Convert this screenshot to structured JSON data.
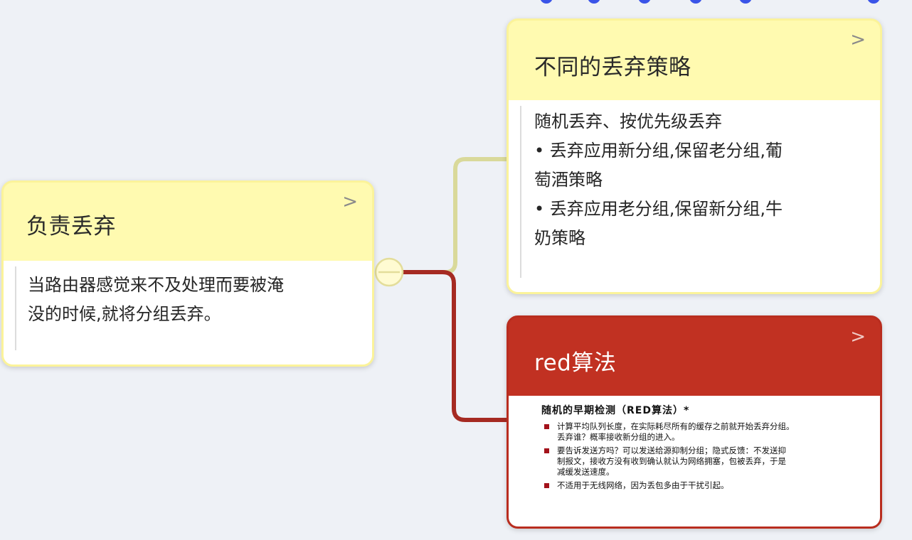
{
  "colors": {
    "canvas": "#eef1f6",
    "yellow_branch": "#d9d99a",
    "red_branch": "#a52a22",
    "top_dots": "#3a54e8"
  },
  "nodes": [
    {
      "title": "负责丢弃",
      "chevron": ">",
      "body_lines": [
        "当路由器感觉来不及处理而要被淹",
        "没的时候,就将分组丢弃。"
      ]
    },
    {
      "title": "不同的丢弃策略",
      "chevron": ">",
      "body_lines": [
        "随机丢弃、按优先级丢弃",
        "• 丢弃应用新分组,保留老分组,葡",
        "萄酒策略",
        "• 丢弃应用老分组,保留新分组,牛",
        "奶策略"
      ]
    },
    {
      "title": "red算法",
      "chevron": ">",
      "slide": {
        "title": "随机的早期检测（RED算法）*",
        "items": [
          {
            "lines": [
              "计算平均队列长度，在实际耗尽所有的缓存之前就开始丢弃分组。",
              "丢弃谁？概率接收新分组的进入。"
            ]
          },
          {
            "lines": [
              "要告诉发送方吗？可以发送给源抑制分组；隐式反馈：不发送抑",
              "制报文，接收方没有收到确认就认为网络拥塞，包被丢弃，于是",
              "减缓发送速度。"
            ]
          },
          {
            "lines": [
              "不适用于无线网络，因为丢包多由于干扰引起。"
            ]
          }
        ]
      }
    }
  ]
}
